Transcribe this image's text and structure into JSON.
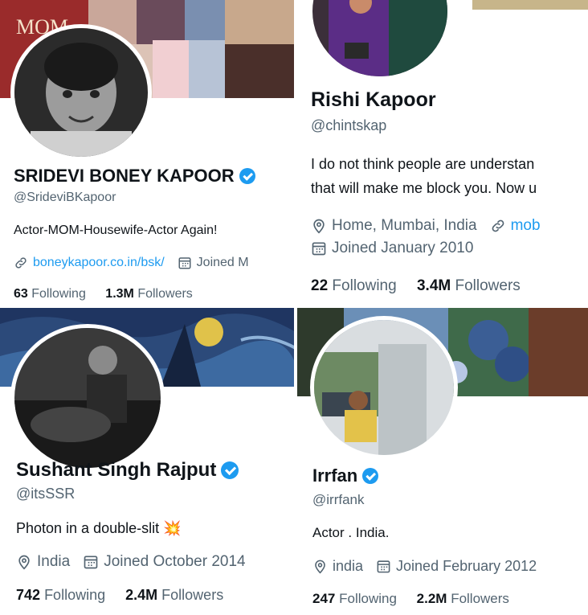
{
  "profiles": [
    {
      "name": "SRIDEVI BONEY KAPOOR",
      "handle": "@SrideviBKapoor",
      "bio": "Actor-MOM-Housewife-Actor Again!",
      "link": "boneykapoor.co.in/bsk/",
      "joined": "Joined M",
      "following": "63",
      "following_label": "Following",
      "followers": "1.3M",
      "followers_label": "Followers",
      "banner_text": "MOM"
    },
    {
      "name": "Rishi Kapoor",
      "handle": "@chintskap",
      "bio_line1": "I do not think people are understan",
      "bio_line2": "that will make me block you. Now u",
      "location": "Home, Mumbai, India",
      "link": "mob",
      "joined": "Joined January 2010",
      "following": "22",
      "following_label": "Following",
      "followers": "3.4M",
      "followers_label": "Followers"
    },
    {
      "name": "Sushant Singh Rajput",
      "handle": "@itsSSR",
      "bio": "Photon in a double-slit",
      "bio_emoji": "💥",
      "location": "India",
      "joined": "Joined October 2014",
      "following": "742",
      "following_label": "Following",
      "followers": "2.4M",
      "followers_label": "Followers"
    },
    {
      "name": "Irrfan",
      "handle": "@irrfank",
      "bio": "Actor . India.",
      "location": "india",
      "joined": "Joined February 2012",
      "following": "247",
      "following_label": "Following",
      "followers": "2.2M",
      "followers_label": "Followers"
    }
  ],
  "colors": {
    "accent": "#1d9bf0",
    "muted": "#536471",
    "text": "#0f1419"
  },
  "icons": [
    "verified-badge-icon",
    "link-icon",
    "calendar-icon",
    "location-icon"
  ]
}
